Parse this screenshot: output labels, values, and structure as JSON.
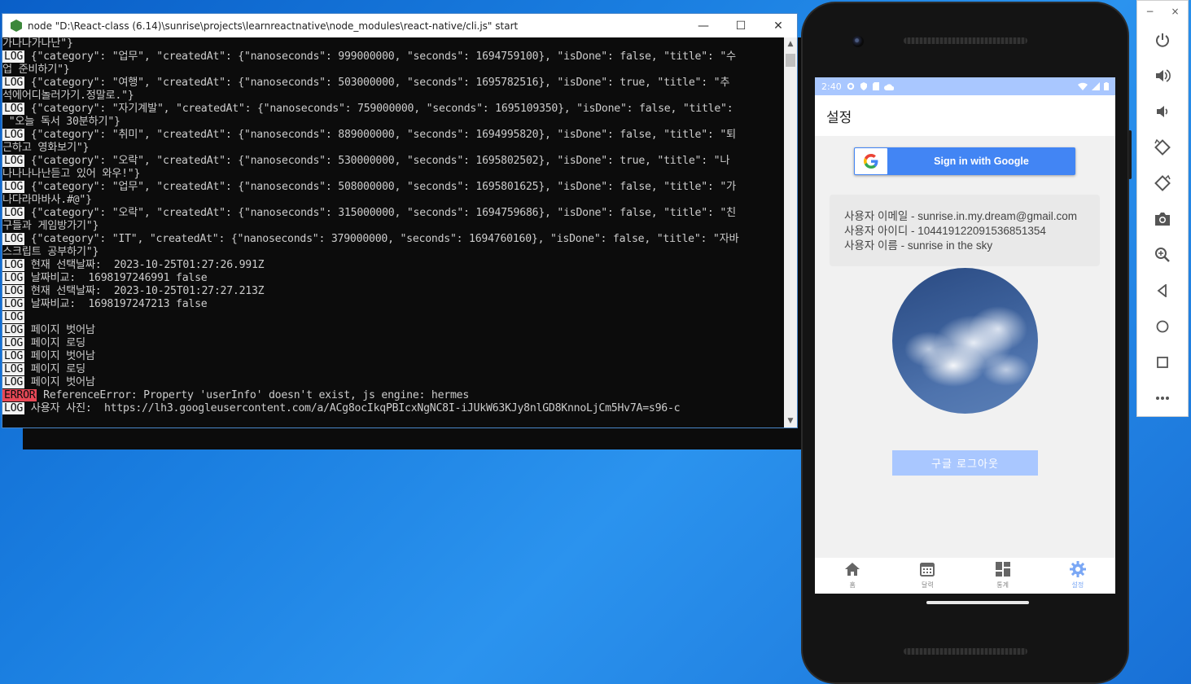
{
  "console": {
    "title": "node  \"D:\\React-class (6.14)\\sunrise\\projects\\learnreactnative\\node_modules\\react-native/cli.js\" start",
    "controls": {
      "minimize": "—",
      "maximize": "☐",
      "close": "✕"
    },
    "lines": [
      {
        "tag": "",
        "text": "가나나가나난\"}"
      },
      {
        "tag": "LOG",
        "text": " {\"category\": \"업무\", \"createdAt\": {\"nanoseconds\": 999000000, \"seconds\": 1694759100}, \"isDone\": false, \"title\": \"수"
      },
      {
        "tag": "",
        "text": "업 준비하기\"}"
      },
      {
        "tag": "LOG",
        "text": " {\"category\": \"여행\", \"createdAt\": {\"nanoseconds\": 503000000, \"seconds\": 1695782516}, \"isDone\": true, \"title\": \"추"
      },
      {
        "tag": "",
        "text": "석에어디놀러가기.정말로.\"}"
      },
      {
        "tag": "LOG",
        "text": " {\"category\": \"자기계발\", \"createdAt\": {\"nanoseconds\": 759000000, \"seconds\": 1695109350}, \"isDone\": false, \"title\":"
      },
      {
        "tag": "",
        "text": " \"오늘 독서 30분하기\"}"
      },
      {
        "tag": "LOG",
        "text": " {\"category\": \"취미\", \"createdAt\": {\"nanoseconds\": 889000000, \"seconds\": 1694995820}, \"isDone\": false, \"title\": \"퇴"
      },
      {
        "tag": "",
        "text": "근하고 영화보기\"}"
      },
      {
        "tag": "LOG",
        "text": " {\"category\": \"오락\", \"createdAt\": {\"nanoseconds\": 530000000, \"seconds\": 1695802502}, \"isDone\": true, \"title\": \"나"
      },
      {
        "tag": "",
        "text": "나나나나난듣고 있어 와우!\"}"
      },
      {
        "tag": "LOG",
        "text": " {\"category\": \"업무\", \"createdAt\": {\"nanoseconds\": 508000000, \"seconds\": 1695801625}, \"isDone\": false, \"title\": \"가"
      },
      {
        "tag": "",
        "text": "나다라마바사.#@\"}"
      },
      {
        "tag": "LOG",
        "text": " {\"category\": \"오락\", \"createdAt\": {\"nanoseconds\": 315000000, \"seconds\": 1694759686}, \"isDone\": false, \"title\": \"친"
      },
      {
        "tag": "",
        "text": "구들과 게임방가기\"}"
      },
      {
        "tag": "LOG",
        "text": " {\"category\": \"IT\", \"createdAt\": {\"nanoseconds\": 379000000, \"seconds\": 1694760160}, \"isDone\": false, \"title\": \"자바"
      },
      {
        "tag": "",
        "text": "스크립트 공부하기\"}"
      },
      {
        "tag": "LOG",
        "text": " 현재 선택날짜:  2023-10-25T01:27:26.991Z"
      },
      {
        "tag": "LOG",
        "text": " 날짜비교:  1698197246991 false"
      },
      {
        "tag": "LOG",
        "text": " 현재 선택날짜:  2023-10-25T01:27:27.213Z"
      },
      {
        "tag": "LOG",
        "text": " 날짜비교:  1698197247213 false"
      },
      {
        "tag": "LOG",
        "text": ""
      },
      {
        "tag": "LOG",
        "text": " 페이지 벗어남"
      },
      {
        "tag": "LOG",
        "text": " 페이지 로딩"
      },
      {
        "tag": "LOG",
        "text": " 페이지 벗어남"
      },
      {
        "tag": "LOG",
        "text": " 페이지 로딩"
      },
      {
        "tag": "LOG",
        "text": " 페이지 벗어남"
      },
      {
        "tag": "ERROR",
        "text": " ReferenceError: Property 'userInfo' doesn't exist, js engine: hermes"
      },
      {
        "tag": "LOG",
        "text": " 사용자 사진:  https://lh3.googleusercontent.com/a/ACg8ocIkqPBIcxNgNC8I-iJUkW63KJy8nlGD8KnnoLjCm5Hv7A=s96-c"
      }
    ]
  },
  "phone": {
    "status": {
      "time": "2:40"
    },
    "appbar_title": "설정",
    "google_button_label": "Sign in with Google",
    "info": [
      "사용자 이메일 - sunrise.in.my.dream@gmail.com",
      "사용자 아이디 - 104419122091536851354",
      "사용자 이름 - sunrise in the sky"
    ],
    "logout_label": "구글 로그아웃",
    "tabs": [
      {
        "label": "홈",
        "icon": "home-icon",
        "active": false
      },
      {
        "label": "달력",
        "icon": "calendar-icon",
        "active": false
      },
      {
        "label": "통계",
        "icon": "dashboard-icon",
        "active": false
      },
      {
        "label": "설정",
        "icon": "gear-icon",
        "active": true
      }
    ],
    "colors": {
      "accent": "#a9c7ff",
      "google_blue": "#4285f4",
      "active_tab": "#7aa7f5"
    }
  },
  "emulator": {
    "controls": {
      "minimize": "−",
      "close": "×"
    },
    "buttons": [
      "power-icon",
      "volume-up-icon",
      "volume-down-icon",
      "rotate-left-icon",
      "rotate-right-icon",
      "camera-icon",
      "zoom-icon",
      "back-icon",
      "home-icon",
      "overview-icon",
      "more-icon"
    ]
  }
}
